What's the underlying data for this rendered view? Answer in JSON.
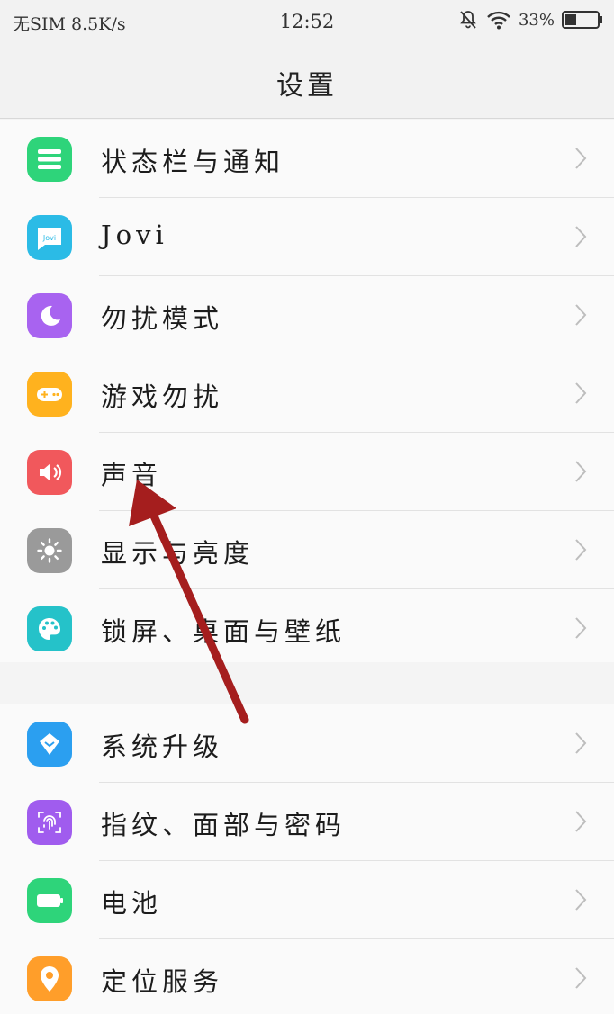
{
  "status_bar": {
    "carrier": "无SIM",
    "net_speed": "8.5K/s",
    "time": "12:52",
    "battery": "33%"
  },
  "header": {
    "title": "设置"
  },
  "group1": [
    {
      "label": "状态栏与通知",
      "icon": "status-bar-icon",
      "color": "#2ed47a"
    },
    {
      "label": "Jovi",
      "icon": "jovi-icon",
      "color": "#2bbbe6",
      "icon_text": "Jovi"
    },
    {
      "label": "勿扰模式",
      "icon": "moon-icon",
      "color": "#a863f0"
    },
    {
      "label": "游戏勿扰",
      "icon": "gamepad-icon",
      "color": "#ffb21e"
    },
    {
      "label": "声音",
      "icon": "speaker-icon",
      "color": "#f1585c"
    },
    {
      "label": "显示与亮度",
      "icon": "sun-icon",
      "color": "#9a9a9a"
    },
    {
      "label": "锁屏、桌面与壁纸",
      "icon": "palette-icon",
      "color": "#25c2c9"
    }
  ],
  "group2": [
    {
      "label": "系统升级",
      "icon": "upgrade-icon",
      "color": "#2b9ff0"
    },
    {
      "label": "指纹、面部与密码",
      "icon": "fingerprint-icon",
      "color": "#a05cee"
    },
    {
      "label": "电池",
      "icon": "battery-icon",
      "color": "#2ed47a"
    },
    {
      "label": "定位服务",
      "icon": "location-icon",
      "color": "#ff9e2a"
    }
  ],
  "annotation": {
    "color": "#a51e1e"
  }
}
